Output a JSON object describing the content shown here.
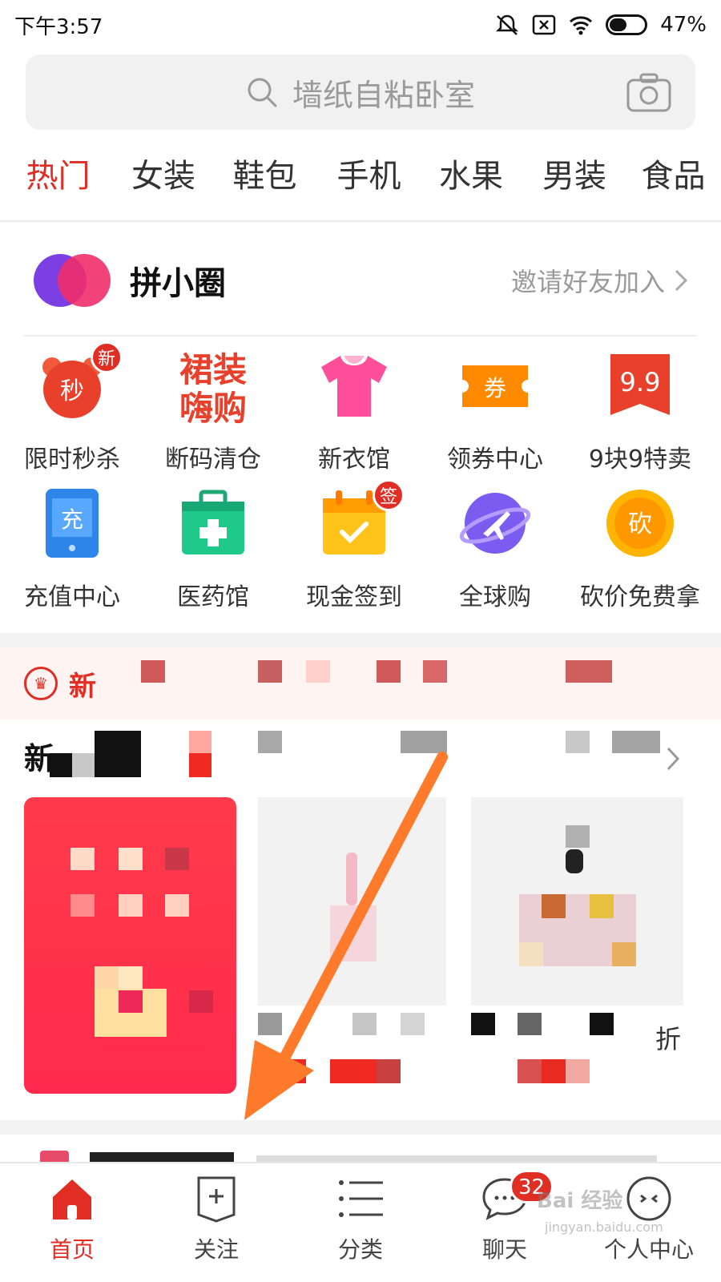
{
  "status_bar": {
    "time": "下午3:57",
    "battery": "47%"
  },
  "search": {
    "placeholder": "墙纸自粘卧室"
  },
  "tabs": [
    {
      "label": "热门",
      "active": true
    },
    {
      "label": "女装"
    },
    {
      "label": "鞋包"
    },
    {
      "label": "手机"
    },
    {
      "label": "水果"
    },
    {
      "label": "男装"
    },
    {
      "label": "食品"
    }
  ],
  "group": {
    "title": "拼小圈",
    "invite": "邀请好友加入"
  },
  "grid": [
    {
      "label": "限时秒杀",
      "icon": "seckill-clock-icon",
      "badge": "新",
      "glyph": "秒"
    },
    {
      "label": "断码清仓",
      "icon": "clearance-text-icon",
      "text": "裙装嗨购"
    },
    {
      "label": "新衣馆",
      "icon": "shirt-icon"
    },
    {
      "label": "领券中心",
      "icon": "coupon-icon",
      "glyph": "券"
    },
    {
      "label": "9块9特卖",
      "icon": "nine-nine-icon",
      "glyph": "9.9"
    },
    {
      "label": "充值中心",
      "icon": "recharge-phone-icon",
      "glyph": "充"
    },
    {
      "label": "医药馆",
      "icon": "medicine-box-icon"
    },
    {
      "label": "现金签到",
      "icon": "calendar-checkin-icon",
      "badge": "签"
    },
    {
      "label": "全球购",
      "icon": "global-plane-icon"
    },
    {
      "label": "砍价免费拿",
      "icon": "bargain-coin-icon",
      "glyph": "砍"
    }
  ],
  "promo": {
    "text_visible": "新"
  },
  "new_section": {
    "title_visible": "新",
    "discount_visible": "折"
  },
  "bottom_nav": [
    {
      "label": "首页",
      "icon": "home-icon",
      "active": true
    },
    {
      "label": "关注",
      "icon": "follow-plus-icon"
    },
    {
      "label": "分类",
      "icon": "category-list-icon"
    },
    {
      "label": "聊天",
      "icon": "chat-icon",
      "badge": "32"
    },
    {
      "label": "个人中心",
      "icon": "profile-icon"
    }
  ],
  "watermark": {
    "main": "Bai 经验",
    "sub": "jingyan.baidu.com"
  },
  "colors": {
    "accent": "#e02e24",
    "arrow": "#ff7a2a"
  }
}
